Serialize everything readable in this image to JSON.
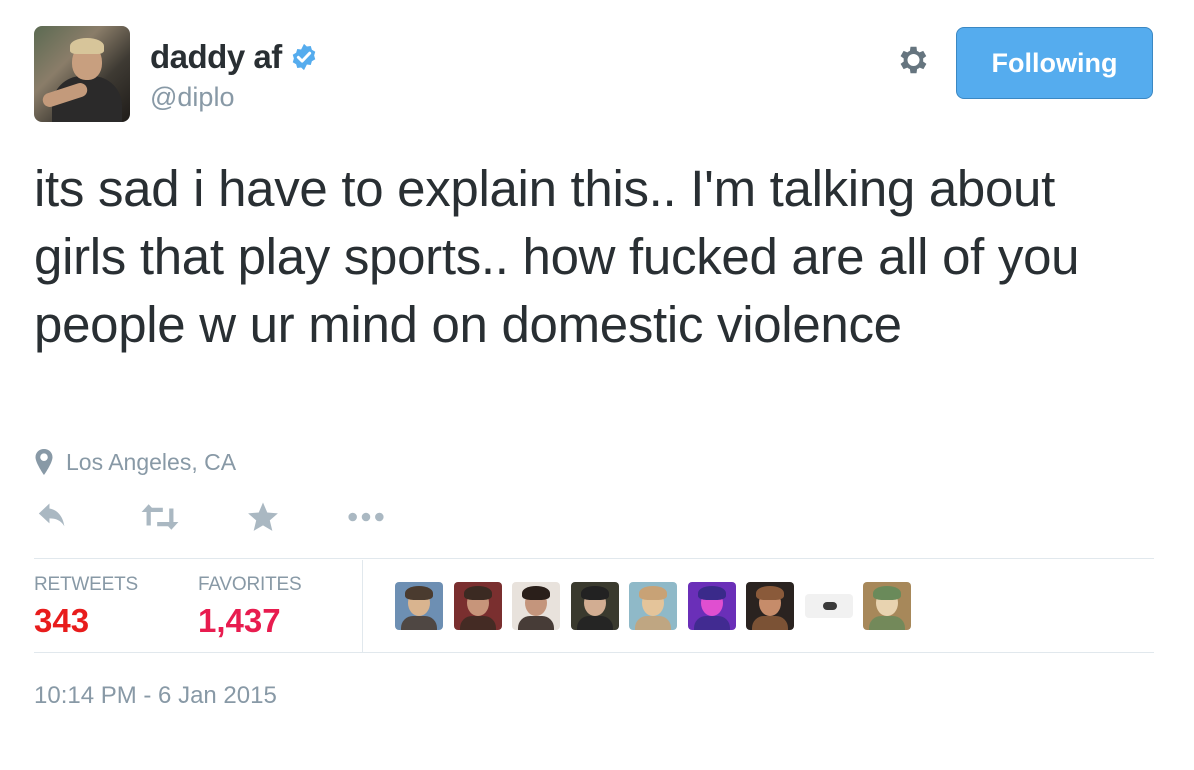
{
  "user": {
    "display_name": "daddy af",
    "handle": "@diplo",
    "avatar_icon": "user-avatar",
    "verified": true
  },
  "follow_button": {
    "label": "Following",
    "color": "#55acee"
  },
  "tweet": {
    "text": "its sad i have to explain this.. I'm talking about girls that play sports.. how fucked are all of you people w ur mind on domestic violence",
    "location": "Los Angeles, CA",
    "timestamp": "10:14 PM - 6 Jan 2015"
  },
  "actions": [
    {
      "name": "reply",
      "icon": "reply-icon"
    },
    {
      "name": "retweet",
      "icon": "retweet-icon"
    },
    {
      "name": "favorite",
      "icon": "star-icon"
    },
    {
      "name": "more",
      "icon": "more-icon"
    }
  ],
  "stats": {
    "retweets_label": "RETWEETS",
    "retweets_value": "343",
    "favorites_label": "FAVORITES",
    "favorites_value": "1,437"
  },
  "favorited_by": [
    {
      "icon": "avatar-1",
      "colors": [
        "#6d8fb3",
        "#d9b48f",
        "#4a3b2f"
      ]
    },
    {
      "icon": "avatar-2",
      "colors": [
        "#7a2f2f",
        "#c7957a",
        "#3b2a22"
      ]
    },
    {
      "icon": "avatar-3",
      "colors": [
        "#e8e2dc",
        "#c4957c",
        "#2a1f1a"
      ]
    },
    {
      "icon": "avatar-4",
      "colors": [
        "#3a3a2e",
        "#d2ad92",
        "#222222"
      ]
    },
    {
      "icon": "avatar-5",
      "colors": [
        "#8fb9c8",
        "#e4c49a",
        "#c8a276"
      ]
    },
    {
      "icon": "avatar-6",
      "colors": [
        "#6a2fb8",
        "#e04fd0",
        "#3a2a8a"
      ]
    },
    {
      "icon": "avatar-7",
      "colors": [
        "#2a2320",
        "#c68c6a",
        "#8a5a3a"
      ]
    },
    {
      "icon": "avatar-8",
      "colors": [
        "#f1f1f1",
        "#9a9a9a",
        "#3a3a3a"
      ]
    },
    {
      "icon": "avatar-9",
      "colors": [
        "#a7885a",
        "#e8d3b0",
        "#6a8a5a"
      ]
    }
  ],
  "colors": {
    "text_primary": "#292f33",
    "text_secondary": "#8899a6",
    "accent_blue": "#55acee",
    "verified_blue": "#55acee",
    "stat_red": "#e81c4f"
  }
}
